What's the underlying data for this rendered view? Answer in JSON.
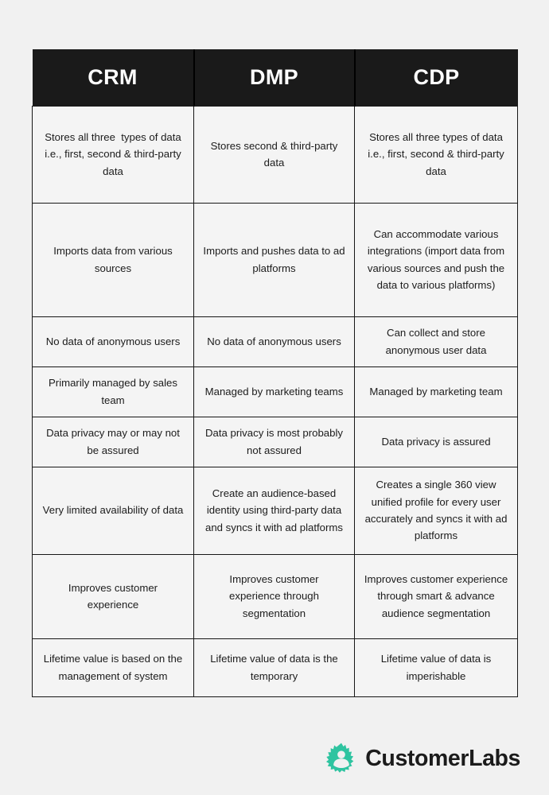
{
  "page": {
    "background_color": "#f1f1f1",
    "cell_background_color": "#f4f4f4",
    "header_background_color": "#1a1a1a",
    "border_color": "#171717",
    "text_color": "#1c1c1c"
  },
  "table": {
    "headers": [
      "CRM",
      "DMP",
      "CDP"
    ],
    "rows": [
      [
        "Stores all three  types of data i.e., first, second & third-party data",
        "Stores second & third-party data",
        "Stores all three types of data  i.e., first, second & third-party data"
      ],
      [
        "Imports data from various sources",
        "Imports and pushes data to ad platforms",
        "Can accommodate various integrations (import data from various sources and push the data to various platforms)"
      ],
      [
        "No data of anonymous users",
        "No data of anonymous users",
        "Can collect and store anonymous user data"
      ],
      [
        "Primarily managed by sales team",
        "Managed by marketing teams",
        "Managed by marketing team"
      ],
      [
        "Data privacy may or may not be assured",
        "Data privacy is most probably not assured",
        "Data privacy is assured"
      ],
      [
        "Very limited availability of data",
        "Create an audience-based identity using third-party data and syncs it with ad platforms",
        "Creates a single 360 view unified profile for every user accurately and syncs it with ad platforms"
      ],
      [
        "Improves customer experience",
        "Improves customer experience through segmentation",
        "Improves customer experience through smart & advance audience segmentation"
      ],
      [
        "Lifetime value is based on the management of system",
        "Lifetime value of data is the temporary",
        "Lifetime value of data is imperishable"
      ]
    ]
  },
  "brand": {
    "name": "CustomerLabs",
    "logo_icon": "gear-person-icon",
    "logo_color": "#2ec4a0",
    "name_color": "#1b1b1b"
  }
}
